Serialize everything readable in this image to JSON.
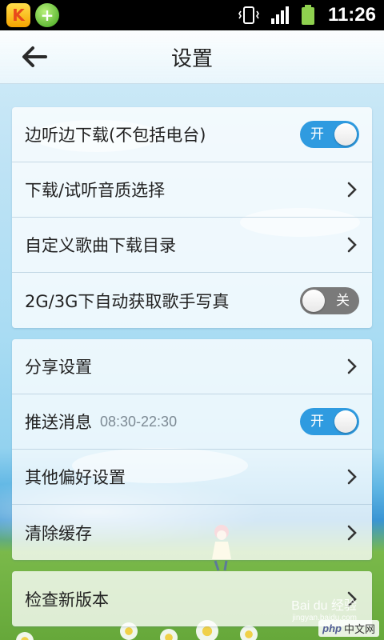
{
  "status_bar": {
    "time": "11:26",
    "apps": [
      "kuwo-k-icon",
      "add-plus-icon"
    ],
    "indicators": [
      "vibrate-icon",
      "signal-icon",
      "battery-icon"
    ]
  },
  "header": {
    "title": "设置"
  },
  "groups": [
    {
      "rows": [
        {
          "label": "边听边下载(不包括电台)",
          "control": "toggle",
          "state": "开",
          "on": true
        },
        {
          "label": "下载/试听音质选择",
          "control": "chevron"
        },
        {
          "label": "自定义歌曲下载目录",
          "control": "chevron"
        },
        {
          "label": "2G/3G下自动获取歌手写真",
          "control": "toggle",
          "state": "关",
          "on": false
        }
      ]
    },
    {
      "rows": [
        {
          "label": "分享设置",
          "control": "chevron"
        },
        {
          "label": "推送消息",
          "sub": "08:30-22:30",
          "control": "toggle",
          "state": "开",
          "on": true
        },
        {
          "label": "其他偏好设置",
          "control": "chevron"
        },
        {
          "label": "清除缓存",
          "control": "chevron"
        }
      ]
    },
    {
      "rows": [
        {
          "label": "检查新版本",
          "control": "chevron"
        }
      ]
    }
  ],
  "watermark": {
    "line1": "Bai du 经验",
    "line2": "jingyan.baidu.com",
    "badge_php": "php",
    "badge_text": "中文网"
  },
  "colors": {
    "toggle_on": "#2f9be0",
    "toggle_off": "#7a7a7a",
    "status_bar": "#000000"
  }
}
